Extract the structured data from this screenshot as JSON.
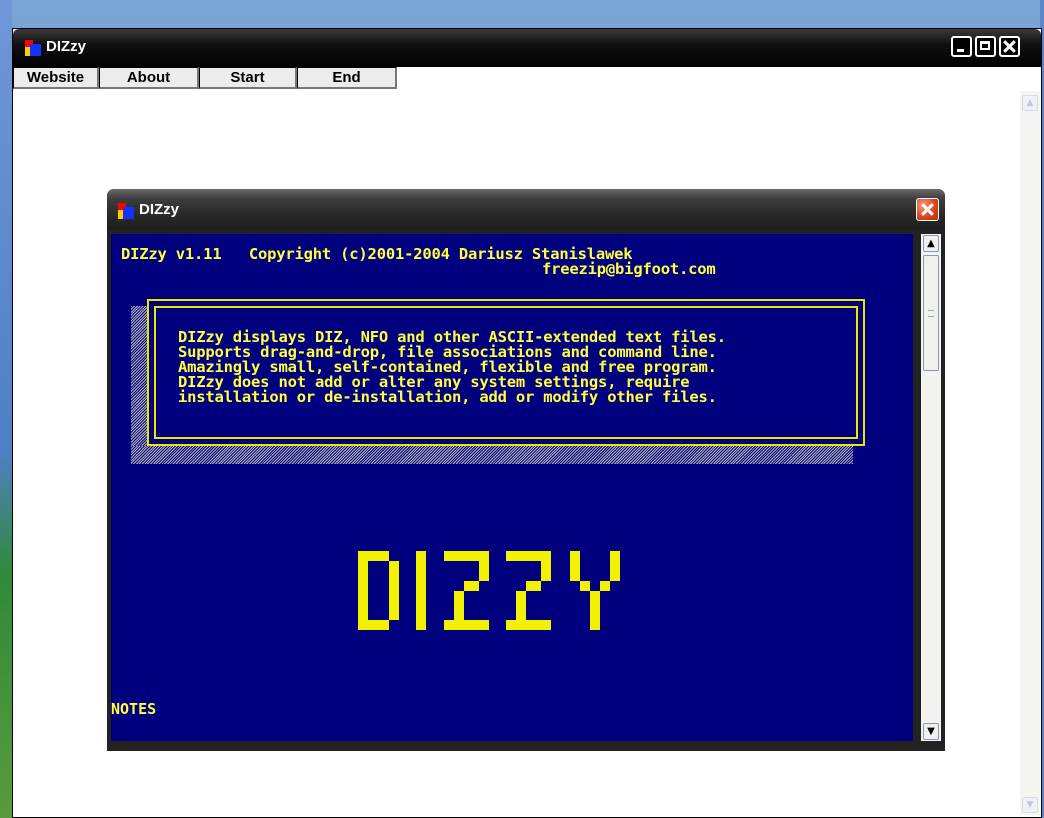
{
  "outer_window": {
    "title": "DIZzy",
    "menu": [
      "Website",
      "About",
      "Start",
      "End"
    ]
  },
  "dialog": {
    "title": "DIZzy",
    "header_line1": "DIZzy v1.11   Copyright (c)2001-2004 Dariusz Stanislawek",
    "header_line2": "freezip@bigfoot.com",
    "description_lines": [
      "DIZzy displays DIZ, NFO and other ASCII-extended text files.",
      "Supports drag-and-drop, file associations and command line.",
      "Amazingly small, self-contained, flexible and free program.",
      "DIZzy does not add or alter any system settings, require",
      "installation or de-installation, add or modify other files."
    ],
    "logo_text": "DIZZY",
    "notes_label": "NOTES"
  },
  "colors": {
    "ascii_background": "#00007f",
    "ascii_text": "#ffff40",
    "titlebar": "#000000"
  },
  "icons": [
    "dizzy-app-icon",
    "minimize-icon",
    "maximize-icon",
    "close-icon",
    "scroll-up-icon",
    "scroll-down-icon"
  ]
}
